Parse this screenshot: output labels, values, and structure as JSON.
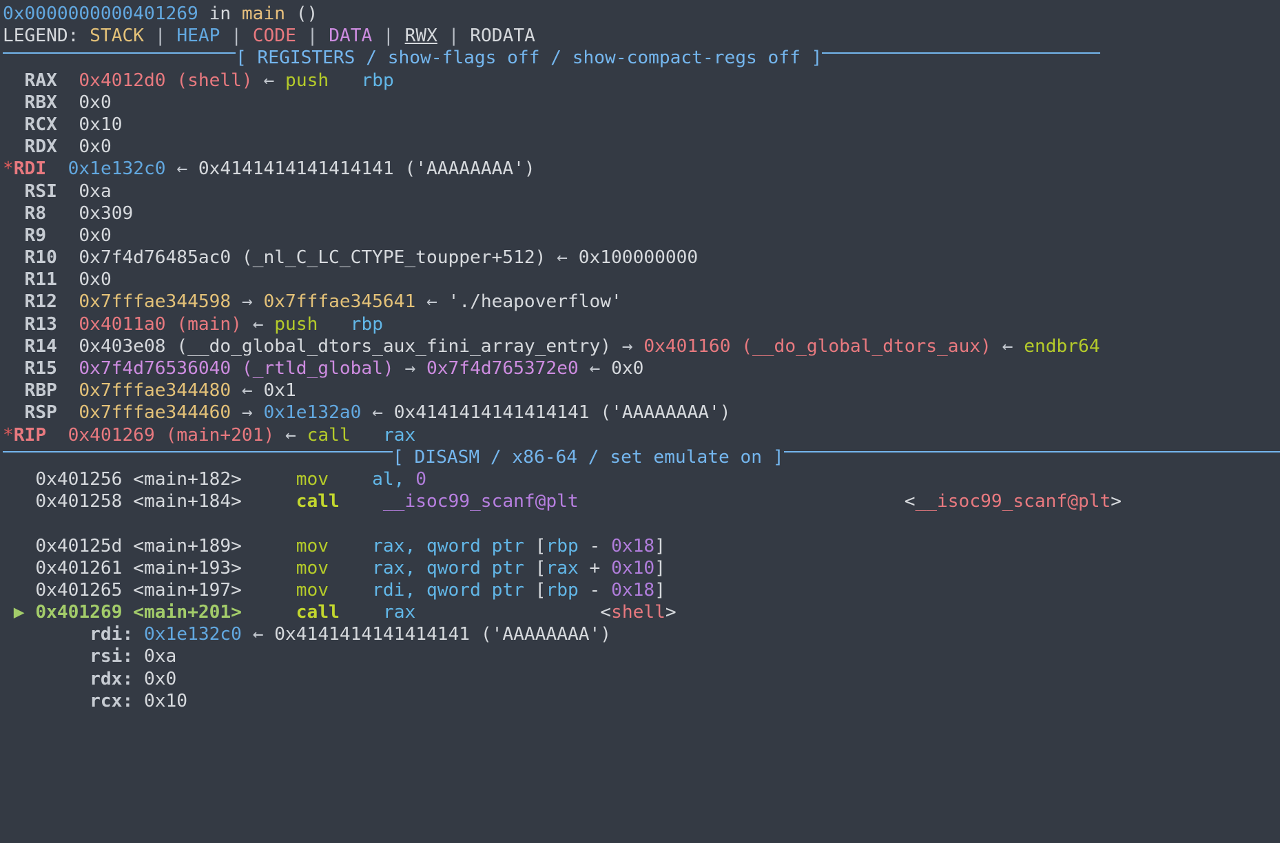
{
  "terminal": {
    "background": "#343a44",
    "foreground": "#d6d9dd"
  },
  "palette": {
    "stack": "#e3c178",
    "heap": "#62a8e0",
    "code": "#e8797f",
    "data": "#cd8ce0",
    "rwx": "#d6d9dd",
    "rodata": "#d6d9dd",
    "banner": "#74b6ee",
    "mnemonic": "#b5cb2a",
    "current_instruction": "#a3cc6a",
    "immediate": "#b07ddb",
    "register_operand": "#62b7e8"
  },
  "stop_line": {
    "address": "0x0000000000401269",
    "in_keyword": "in",
    "function": "main",
    "parens": "()"
  },
  "legend": {
    "label": "LEGEND:",
    "items": [
      {
        "name": "STACK",
        "color": "#e3c178"
      },
      {
        "name": "HEAP",
        "color": "#62a8e0"
      },
      {
        "name": "CODE",
        "color": "#e8797f"
      },
      {
        "name": "DATA",
        "color": "#cd8ce0"
      },
      {
        "name": "RWX",
        "color": "#d6d9dd"
      },
      {
        "name": "RODATA",
        "color": "#d6d9dd"
      }
    ],
    "separator": "|"
  },
  "registers_banner": "[ REGISTERS / show-flags off / show-compact-regs off ]",
  "disasm_banner": "[ DISASM / x86-64 / set emulate on ]",
  "registers": [
    {
      "star": "",
      "name": "RAX",
      "line": "0x4012d0 (shell) ← push   rbp"
    },
    {
      "star": "",
      "name": "RBX",
      "line": "0x0"
    },
    {
      "star": "",
      "name": "RCX",
      "line": "0x10"
    },
    {
      "star": "",
      "name": "RDX",
      "line": "0x0"
    },
    {
      "star": "*",
      "name": "RDI",
      "line": "0x1e132c0 ← 0x4141414141414141 ('AAAAAAAA')"
    },
    {
      "star": "",
      "name": "RSI",
      "line": "0xa"
    },
    {
      "star": "",
      "name": "R8",
      "line": "0x309"
    },
    {
      "star": "",
      "name": "R9",
      "line": "0x0"
    },
    {
      "star": "",
      "name": "R10",
      "line": "0x7f4d76485ac0 (_nl_C_LC_CTYPE_toupper+512) ← 0x100000000"
    },
    {
      "star": "",
      "name": "R11",
      "line": "0x0"
    },
    {
      "star": "",
      "name": "R12",
      "line": "0x7fffae344598 → 0x7fffae345641 ← './heapoverflow'"
    },
    {
      "star": "",
      "name": "R13",
      "line": "0x4011a0 (main) ← push   rbp"
    },
    {
      "star": "",
      "name": "R14",
      "line": "0x403e08 (__do_global_dtors_aux_fini_array_entry) → 0x401160 (__do_global_dtors_aux) ← endbr64"
    },
    {
      "star": "",
      "name": "R15",
      "line": "0x7f4d76536040 (_rtld_global) → 0x7f4d765372e0 ← 0x0"
    },
    {
      "star": "",
      "name": "RBP",
      "line": "0x7fffae344480 ← 0x1"
    },
    {
      "star": "",
      "name": "RSP",
      "line": "0x7fffae344460 → 0x1e132a0 ← 0x4141414141414141 ('AAAAAAAA')"
    },
    {
      "star": "*",
      "name": "RIP",
      "line": "0x401269 (main+201) ← call   rax"
    }
  ],
  "register_values": {
    "rax": {
      "addr": "0x4012d0",
      "sym": "(shell)",
      "arrow": "←",
      "mnem": "push",
      "operand": "rbp"
    },
    "rbx": {
      "value": "0x0"
    },
    "rcx": {
      "value": "0x10"
    },
    "rdx": {
      "value": "0x0"
    },
    "rdi": {
      "addr": "0x1e132c0",
      "arrow": "←",
      "value": "0x4141414141414141",
      "ascii": "('AAAAAAAA')"
    },
    "rsi": {
      "value": "0xa"
    },
    "r8": {
      "value": "0x309"
    },
    "r9": {
      "value": "0x0"
    },
    "r10": {
      "addr": "0x7f4d76485ac0",
      "sym": "(_nl_C_LC_CTYPE_toupper+512)",
      "arrow": "←",
      "value": "0x100000000"
    },
    "r11": {
      "value": "0x0"
    },
    "r12": {
      "addr": "0x7fffae344598",
      "arrow1": "→",
      "addr2": "0x7fffae345641",
      "arrow2": "←",
      "value": "'./heapoverflow'"
    },
    "r13": {
      "addr": "0x4011a0",
      "sym": "(main)",
      "arrow": "←",
      "mnem": "push",
      "operand": "rbp"
    },
    "r14": {
      "addr": "0x403e08",
      "sym": "(__do_global_dtors_aux_fini_array_entry)",
      "arrow1": "→",
      "addr2": "0x401160",
      "sym2": "(__do_global_dtors_aux)",
      "arrow2": "←",
      "mnem": "endbr64"
    },
    "r15": {
      "addr": "0x7f4d76536040",
      "sym": "(_rtld_global)",
      "arrow1": "→",
      "addr2": "0x7f4d765372e0",
      "arrow2": "←",
      "value": "0x0"
    },
    "rbp": {
      "addr": "0x7fffae344480",
      "arrow": "←",
      "value": "0x1"
    },
    "rsp": {
      "addr": "0x7fffae344460",
      "arrow1": "→",
      "addr2": "0x1e132a0",
      "arrow2": "←",
      "value": "0x4141414141414141",
      "ascii": "('AAAAAAAA')"
    },
    "rip": {
      "addr": "0x401269",
      "sym": "(main+201)",
      "arrow": "←",
      "mnem": "call",
      "operand": "rax"
    }
  },
  "register_names": {
    "rax": "RAX",
    "rbx": "RBX",
    "rcx": "RCX",
    "rdx": "RDX",
    "rdi": "RDI",
    "rsi": "RSI",
    "r8": "R8",
    "r9": "R9",
    "r10": "R10",
    "r11": "R11",
    "r12": "R12",
    "r13": "R13",
    "r14": "R14",
    "r15": "R15",
    "rbp": "RBP",
    "rsp": "RSP",
    "rip": "RIP",
    "star": "*"
  },
  "disasm": [
    {
      "marker": "",
      "address": "0x401256",
      "symbol": "<main+182>",
      "mnemonic": "mov",
      "operands_plain": "al, 0",
      "annotation": "",
      "current": false
    },
    {
      "marker": "",
      "address": "0x401258",
      "symbol": "<main+184>",
      "mnemonic": "call",
      "operands_plain": "__isoc99_scanf@plt",
      "annotation": "<__isoc99_scanf@plt>",
      "current": false
    },
    {
      "marker": "",
      "address": "0x40125d",
      "symbol": "<main+189>",
      "mnemonic": "mov",
      "operands_plain": "rax, qword ptr [rbp - 0x18]",
      "annotation": "",
      "current": false
    },
    {
      "marker": "",
      "address": "0x401261",
      "symbol": "<main+193>",
      "mnemonic": "mov",
      "operands_plain": "rax, qword ptr [rax + 0x10]",
      "annotation": "",
      "current": false
    },
    {
      "marker": "",
      "address": "0x401265",
      "symbol": "<main+197>",
      "mnemonic": "mov",
      "operands_plain": "rdi, qword ptr [rbp - 0x18]",
      "annotation": "",
      "current": false
    },
    {
      "marker": "▶",
      "address": "0x401269",
      "symbol": "<main+201>",
      "mnemonic": "call",
      "operands_plain": "rax",
      "annotation": "<shell>",
      "current": true
    }
  ],
  "disasm_tokens": {
    "l1_mnem": "mov",
    "l1_op1": "al,",
    "l1_imm": "0",
    "l2_mnem": "call",
    "l2_target": "__isoc99_scanf@plt",
    "l2_annot": "<__isoc99_scanf@plt>",
    "l3_mnem": "mov",
    "l3_reg": "rax,",
    "l3_ptr": "qword ptr",
    "l3_base": "rbp",
    "l3_sign": "-",
    "l3_disp": "0x18",
    "l4_mnem": "mov",
    "l4_reg": "rax,",
    "l4_ptr": "qword ptr",
    "l4_base": "rax",
    "l4_sign": "+",
    "l4_disp": "0x10",
    "l5_mnem": "mov",
    "l5_reg": "rdi,",
    "l5_ptr": "qword ptr",
    "l5_base": "rbp",
    "l5_sign": "-",
    "l5_disp": "0x18",
    "l6_marker": "▶",
    "l6_addr": "0x401269",
    "l6_sym": "<main+201>",
    "l6_mnem": "call",
    "l6_op": "rax",
    "l6_annot": "<shell>",
    "addr1": "0x401256",
    "sym1": "<main+182>",
    "addr2": "0x401258",
    "sym2": "<main+184>",
    "addr3": "0x40125d",
    "sym3": "<main+189>",
    "addr4": "0x401261",
    "sym4": "<main+193>",
    "addr5": "0x401265",
    "sym5": "<main+197>"
  },
  "call_args": [
    {
      "name": "rdi:",
      "value_addr": "0x1e132c0",
      "arrow": "←",
      "value": "0x4141414141414141",
      "ascii": "('AAAAAAAA')"
    },
    {
      "name": "rsi:",
      "value_addr": "",
      "arrow": "",
      "value": "0xa",
      "ascii": ""
    },
    {
      "name": "rdx:",
      "value_addr": "",
      "arrow": "",
      "value": "0x0",
      "ascii": ""
    },
    {
      "name": "rcx:",
      "value_addr": "",
      "arrow": "",
      "value": "0x10",
      "ascii": ""
    }
  ]
}
